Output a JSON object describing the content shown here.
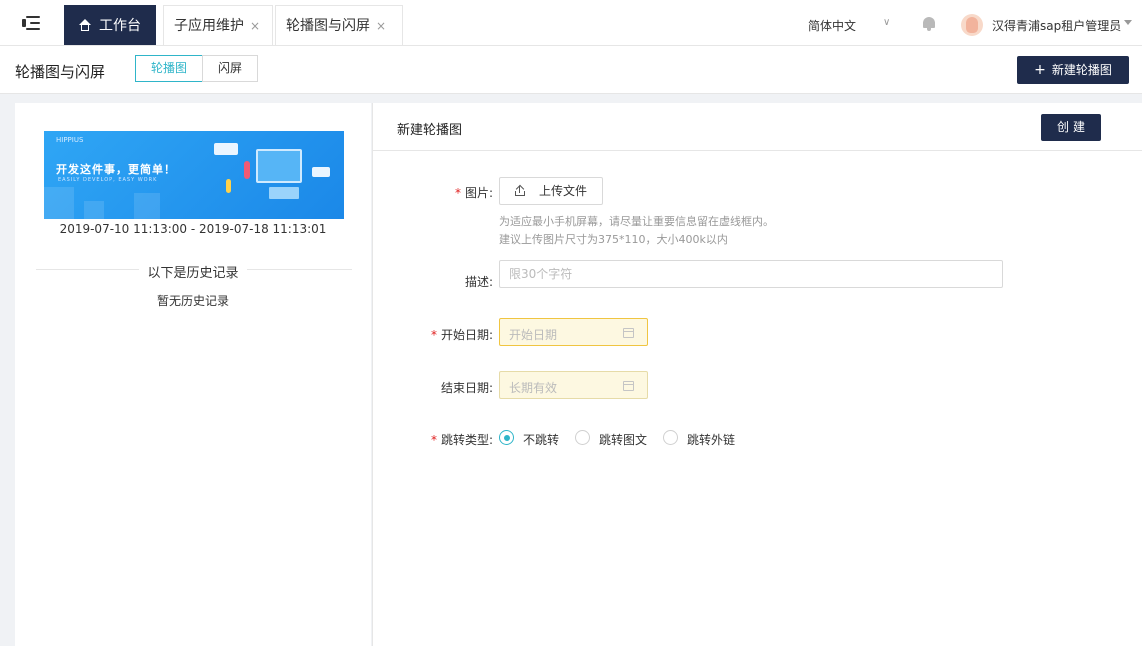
{
  "tabs": [
    {
      "label": "工作台"
    },
    {
      "label": "子应用维护",
      "close": "×"
    },
    {
      "label": "轮播图与闪屏",
      "close": "×"
    }
  ],
  "header": {
    "language": "简体中文",
    "language_chevron": "∨",
    "user_name": "汉得青浦sap租户管理员"
  },
  "subheader": {
    "title": "轮播图与闪屏",
    "segments": [
      "轮播图",
      "闪屏"
    ],
    "new_button": {
      "icon": "+",
      "label": "新建轮播图"
    }
  },
  "left_panel": {
    "banner": {
      "brand": "HIPPIUS",
      "slogan": "开发这件事，更简单！",
      "slogan_en": "EASILY DEVELOP, EASY WORK"
    },
    "date_range": "2019-07-10 11:13:00 - 2019-07-18 11:13:01",
    "history_title": "以下是历史记录",
    "history_empty": "暂无历史记录"
  },
  "form": {
    "title": "新建轮播图",
    "create_label": "创建",
    "image_label": "图片:",
    "upload_label": "上传文件",
    "hint_1": "为适应最小手机屏幕，请尽量让重要信息留在虚线框内。",
    "hint_2": "建议上传图片尺寸为375*110，大小400k以内",
    "desc_label": "描述:",
    "desc_placeholder": "限30个字符",
    "start_label": "开始日期:",
    "start_placeholder": "开始日期",
    "end_label": "结束日期:",
    "end_placeholder": "长期有效",
    "jump_label": "跳转类型:",
    "jump_options": [
      "不跳转",
      "跳转图文",
      "跳转外链"
    ],
    "jump_selected": "不跳转",
    "required_mark": "*"
  },
  "colors": {
    "nav_dark": "#1f2c4c",
    "accent": "#2fb5c9",
    "required": "#e02020",
    "date_bg": "#fdf8e1"
  }
}
